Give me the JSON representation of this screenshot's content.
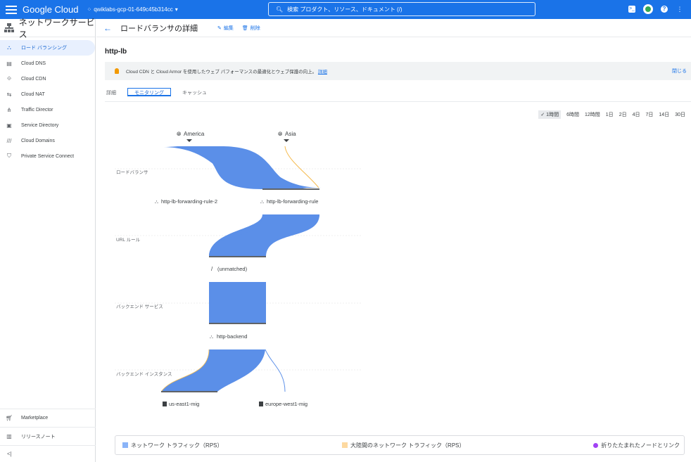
{
  "topbar": {
    "brand": "Google Cloud",
    "project": "qwiklabs-gcp-01-649c45b314cc",
    "search_placeholder": "検索 プロダクト、リソース、ドキュメント (/)",
    "icons": [
      "menu-icon",
      "project-icon",
      "search-icon",
      "terminal-icon",
      "avatar",
      "help-icon",
      "more-icon"
    ]
  },
  "sidebar": {
    "title": "ネットワークサービス",
    "items": [
      {
        "label": "ロード バランシング",
        "icon": "load-balancer-icon",
        "active": true
      },
      {
        "label": "Cloud DNS",
        "icon": "dns-icon"
      },
      {
        "label": "Cloud CDN",
        "icon": "cdn-icon"
      },
      {
        "label": "Cloud NAT",
        "icon": "nat-icon"
      },
      {
        "label": "Traffic Director",
        "icon": "traffic-icon"
      },
      {
        "label": "Service Directory",
        "icon": "directory-icon"
      },
      {
        "label": "Cloud Domains",
        "icon": "domains-icon"
      },
      {
        "label": "Private Service Connect",
        "icon": "shield-icon"
      }
    ],
    "bottom": [
      {
        "label": "Marketplace",
        "icon": "cart-icon"
      },
      {
        "label": "リリースノート",
        "icon": "notes-icon"
      }
    ],
    "collapse": "<|"
  },
  "header": {
    "back": "←",
    "title": "ロードバランサの詳細",
    "edit": "編集",
    "delete": "削除"
  },
  "lb_name": "http-lb",
  "banner": {
    "text": "Cloud CDN と Cloud Armor を使用したウェブ パフォーマンスの最適化とウェブ保護の向上。",
    "link": "詳細",
    "close": "閉じる"
  },
  "tabs": [
    {
      "label": "詳細",
      "active": false
    },
    {
      "label": "モニタリング",
      "active": true
    },
    {
      "label": "キャッシュ",
      "active": false
    }
  ],
  "time_range": {
    "options": [
      "1時間",
      "6時間",
      "12時間",
      "1日",
      "2日",
      "4日",
      "7日",
      "14日",
      "30日"
    ],
    "selected": "1時間"
  },
  "flow": {
    "regions": [
      "America",
      "Asia"
    ],
    "rows": [
      "ロードバランサ",
      "URL ルール",
      "バックエンド サービス",
      "バックエンド インスタンス"
    ],
    "forwarding_rules": [
      "http-lb-forwarding-rule-2",
      "http-lb-forwarding-rule"
    ],
    "url_rule": "(unmatched)",
    "backend_service": "http-backend",
    "instances": [
      "us-east1-mig",
      "europe-west1-mig"
    ]
  },
  "legend": {
    "network": "ネットワーク トラフィック（RPS）",
    "intercontinental": "大陸間のネットワーク トラフィック（RPS）",
    "collapsed": "折りたたまれたノードとリンク",
    "colors": {
      "network": "#8ab4f8",
      "intercontinental": "#fdd9a0",
      "collapsed": "#a142f4"
    }
  }
}
